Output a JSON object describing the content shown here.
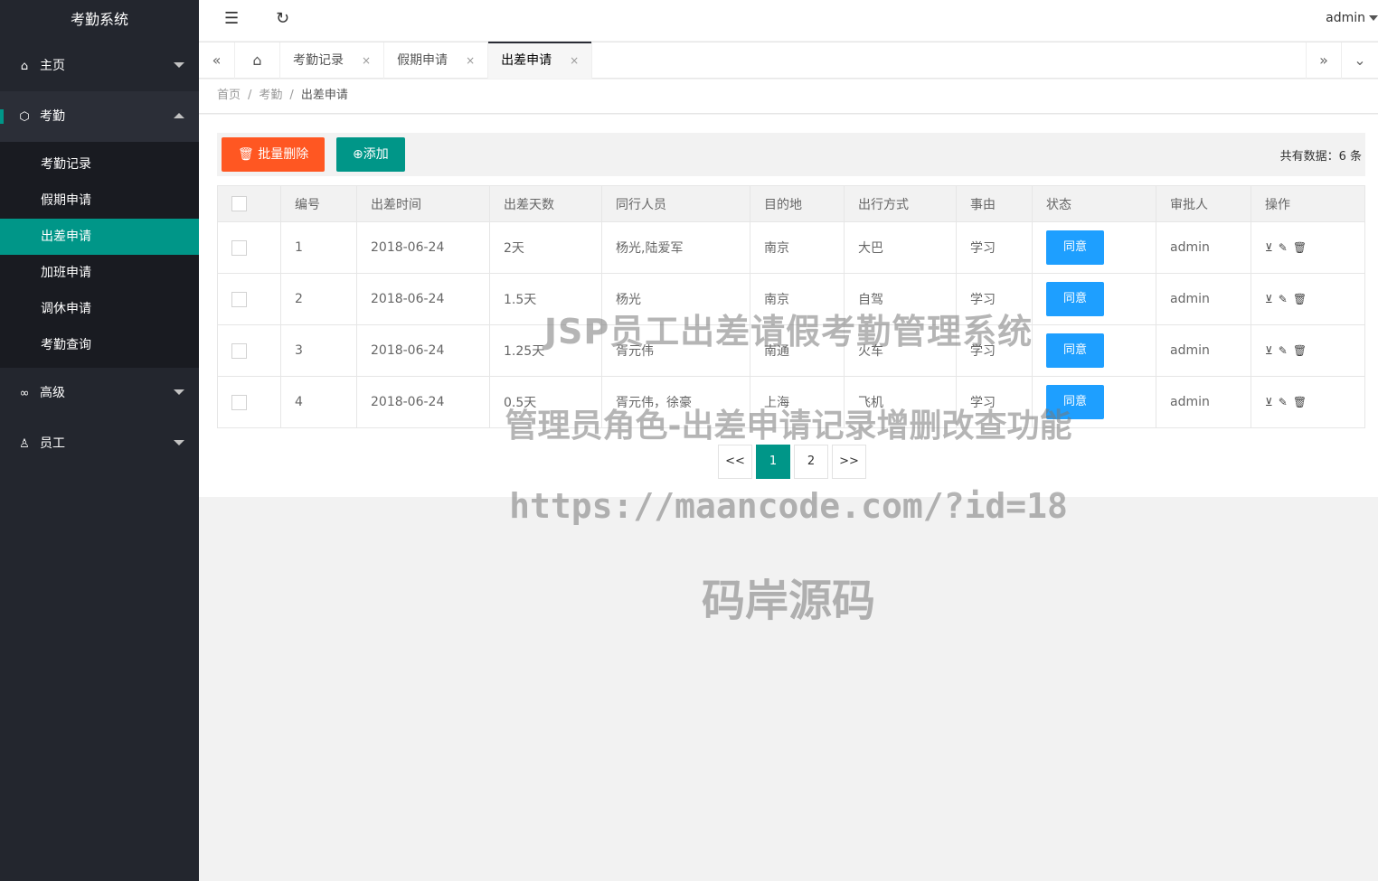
{
  "app": {
    "title": "考勤系统",
    "user": "admin"
  },
  "sidebar": {
    "items": [
      {
        "label": "主页",
        "icon": "home-icon"
      },
      {
        "label": "考勤",
        "icon": "cube-icon"
      },
      {
        "label": "高级",
        "icon": "link-icon"
      },
      {
        "label": "员工",
        "icon": "user-icon"
      }
    ],
    "attendance_sub": [
      "考勤记录",
      "假期申请",
      "出差申请",
      "加班申请",
      "调休申请",
      "考勤查询"
    ],
    "active_sub": "出差申请"
  },
  "tabs": [
    {
      "label": "考勤记录",
      "close": "×"
    },
    {
      "label": "假期申请",
      "close": "×"
    },
    {
      "label": "出差申请",
      "close": "×"
    }
  ],
  "breadcrumb": {
    "home": "首页",
    "parent": "考勤",
    "current": "出差申请",
    "sep": "/"
  },
  "toolbar": {
    "batch_delete": "批量删除",
    "add": "添加",
    "total": "共有数据：6 条"
  },
  "table": {
    "headers": [
      "编号",
      "出差时间",
      "出差天数",
      "同行人员",
      "目的地",
      "出行方式",
      "事由",
      "状态",
      "审批人",
      "操作"
    ],
    "rows": [
      {
        "id": "1",
        "date": "2018-06-24",
        "days": "2天",
        "companions": "杨光,陆爱军",
        "dest": "南京",
        "mode": "大巴",
        "reason": "学习",
        "status": "同意",
        "approver": "admin"
      },
      {
        "id": "2",
        "date": "2018-06-24",
        "days": "1.5天",
        "companions": "杨光",
        "dest": "南京",
        "mode": "自驾",
        "reason": "学习",
        "status": "同意",
        "approver": "admin"
      },
      {
        "id": "3",
        "date": "2018-06-24",
        "days": "1.25天",
        "companions": "胥元伟",
        "dest": "南通",
        "mode": "火车",
        "reason": "学习",
        "status": "同意",
        "approver": "admin"
      },
      {
        "id": "4",
        "date": "2018-06-24",
        "days": "0.5天",
        "companions": "胥元伟，徐豪",
        "dest": "上海",
        "mode": "飞机",
        "reason": "学习",
        "status": "同意",
        "approver": "admin"
      }
    ]
  },
  "pager": {
    "prev": "<<",
    "pages": [
      "1",
      "2"
    ],
    "next": ">>",
    "current": "1"
  },
  "watermark": {
    "line1": "JSP员工出差请假考勤管理系统",
    "line2": "管理员角色-出差申请记录增删改查功能",
    "line3": "https://maancode.com/?id=18",
    "line4": "码岸源码"
  },
  "colors": {
    "sidebar": "#23262e",
    "accent": "#009688",
    "danger": "#ff5722",
    "primary": "#1e9fff"
  }
}
